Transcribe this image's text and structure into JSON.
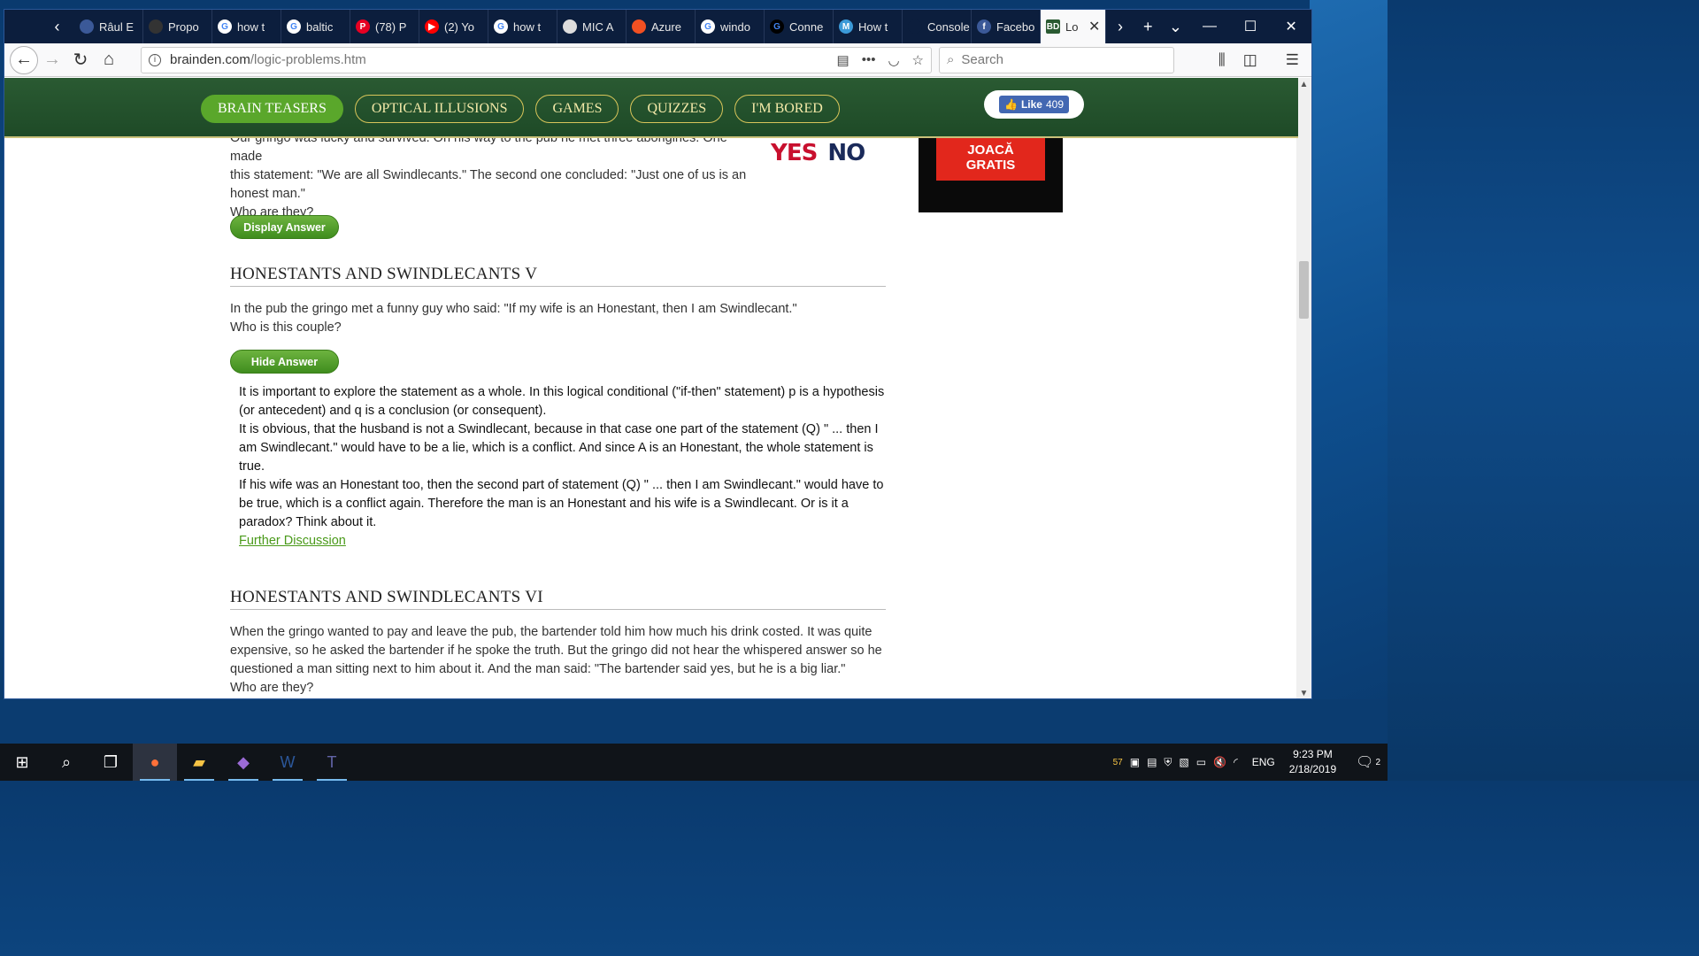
{
  "browser": {
    "tabs": [
      {
        "label": "Râul E",
        "fav": "",
        "color": "#3b5998"
      },
      {
        "label": "Propo",
        "fav": "",
        "color": "#333333"
      },
      {
        "label": "how t",
        "fav": "G",
        "color": "#ffffff"
      },
      {
        "label": "baltic",
        "fav": "G",
        "color": "#ffffff"
      },
      {
        "label": "(78) P",
        "fav": "P",
        "color": "#e60023"
      },
      {
        "label": "(2) Yo",
        "fav": "▶",
        "color": "#ff0000"
      },
      {
        "label": "how t",
        "fav": "G",
        "color": "#ffffff"
      },
      {
        "label": "MIC A",
        "fav": "",
        "color": "#dddddd"
      },
      {
        "label": "Azure",
        "fav": "",
        "color": "#f25022"
      },
      {
        "label": "windo",
        "fav": "G",
        "color": "#ffffff"
      },
      {
        "label": "Conne",
        "fav": "G",
        "color": "#000000"
      },
      {
        "label": "How t",
        "fav": "M",
        "color": "#3c9ad8"
      },
      {
        "label": "Console A",
        "fav": "",
        "color": "#0c1e3d"
      },
      {
        "label": "Facebo",
        "fav": "f",
        "color": "#3b5998"
      }
    ],
    "active_tab": {
      "label": "Lo",
      "fav": "BD"
    },
    "url_domain": "brainden.com",
    "url_path": "/logic-problems.htm",
    "search_placeholder": "Search"
  },
  "site": {
    "menu": [
      "BRAIN TEASERS",
      "OPTICAL ILLUSIONS",
      "GAMES",
      "QUIZZES",
      "I'M BORED"
    ],
    "fb_like": "Like",
    "fb_count": "409",
    "ad_text_1": "JOACĂ",
    "ad_text_2": "GRATIS",
    "yes": "YES",
    "no": "NO"
  },
  "content": {
    "intro_line1": "Our gringo was lucky and survived. On his way to the pub he met three aborigines. One made",
    "intro_line2": "this statement: \"We are all Swindlecants.\" The second one concluded: \"Just one of us is an",
    "intro_line3": "honest man.\"",
    "intro_question": "Who are they?",
    "display_answer": "Display Answer",
    "section5_title": "HONESTANTS AND SWINDLECANTS V",
    "section5_text": "In the pub the gringo met a funny guy who said: \"If my wife is an Honestant, then I am Swindlecant.\"",
    "section5_question": "Who is this couple?",
    "hide_answer": "Hide Answer",
    "answer_p1": "It is important to explore the statement as a whole. In this logical conditional (\"if-then\" statement) p is a hypothesis (or antecedent) and q is a conclusion (or consequent).",
    "answer_p2": "It is obvious, that the husband is not a Swindlecant, because in that case one part of the statement (Q) \" ... then I am Swindlecant.\" would have to be a lie, which is a conflict. And since A is an Honestant, the whole statement is true.",
    "answer_p3": "If his wife was an Honestant too, then the second part of statement (Q) \" ... then I am Swindlecant.\" would have to be true, which is a conflict again. Therefore the man is an Honestant and his wife is a Swindlecant. Or is it a paradox? Think about it.",
    "further_discussion": "Further Discussion",
    "section6_title": "HONESTANTS AND SWINDLECANTS VI",
    "section6_text": "When the gringo wanted to pay and leave the pub, the bartender told him how much his drink costed. It was quite expensive, so he asked the bartender if he spoke the truth. But the gringo did not hear the whispered answer so he questioned a man sitting next to him about it. And the man said: \"The bartender said yes, but he is a big liar.\"",
    "section6_question": "Who are they?"
  },
  "taskbar": {
    "weather": "57",
    "lang": "ENG",
    "time": "9:23 PM",
    "date": "2/18/2019",
    "notifications": "2"
  }
}
